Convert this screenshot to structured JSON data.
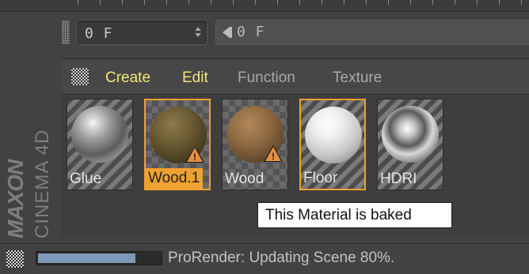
{
  "timeline": {
    "frame_value": "0 F",
    "slider_value": "0 F"
  },
  "menu": {
    "items": [
      {
        "label": "Create",
        "highlighted": true
      },
      {
        "label": "Edit",
        "highlighted": true
      },
      {
        "label": "Function",
        "highlighted": false
      },
      {
        "label": "Texture",
        "highlighted": false
      }
    ]
  },
  "materials": [
    {
      "name": "Glue",
      "warning": false,
      "selected": false
    },
    {
      "name": "Wood.1",
      "warning": true,
      "selected": true
    },
    {
      "name": "Wood",
      "warning": true,
      "selected": false
    },
    {
      "name": "Floor",
      "warning": false,
      "selected": false
    },
    {
      "name": "HDRI",
      "warning": false,
      "selected": false
    }
  ],
  "tooltip": "This Material is baked",
  "logo": {
    "brand": "MAXON",
    "product": "CINEMA 4D"
  },
  "status": {
    "text": "ProRender: Updating Scene 80%.",
    "progress": 0.8
  },
  "icons": {
    "spin": "spinner-arrows-icon",
    "grip": "drag-grip-icon",
    "warning": "warning-triangle-icon"
  },
  "colors": {
    "menu_highlight": "#f2e878",
    "selection": "#f0a030",
    "progress_fill": "#7e9ab6"
  }
}
